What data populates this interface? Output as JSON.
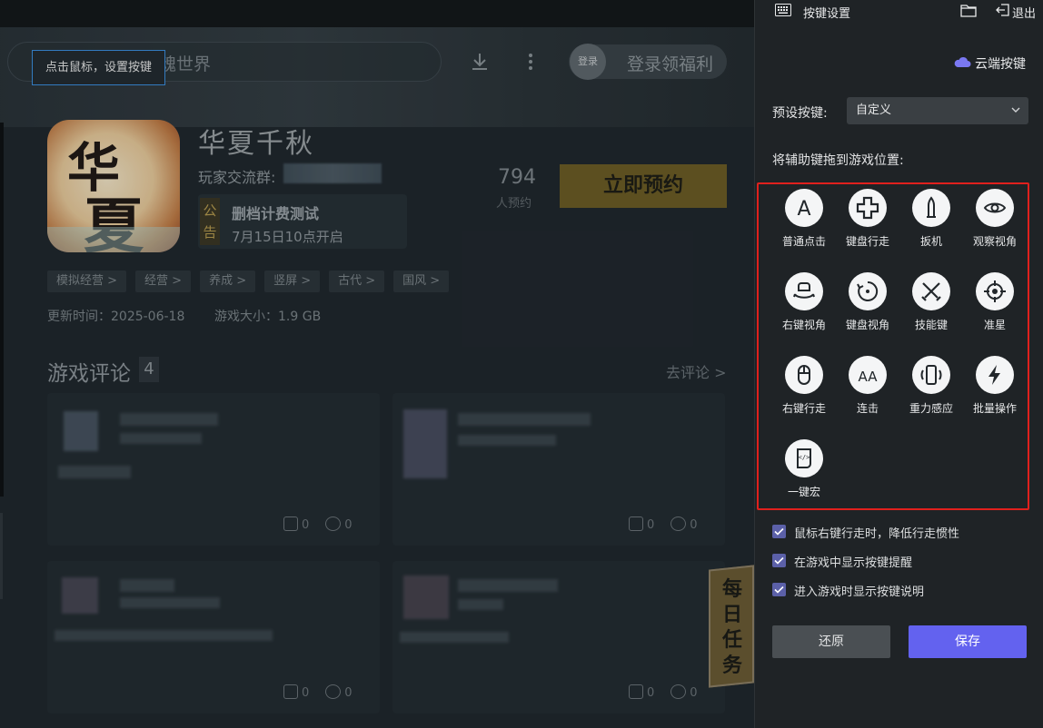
{
  "game_page": {
    "search_text": "魂世界",
    "tooltip": "点击鼠标，设置按键",
    "login_avatar": "登录",
    "login_text": "登录领福利",
    "title": "华夏千秋",
    "group_label": "玩家交流群:",
    "notice_tag": "公告",
    "notice_title": "删档计费测试",
    "notice_sub": "7月15日10点开启",
    "reserve_count": "794",
    "reserve_count_label": "人预约",
    "reserve_button": "立即预约",
    "tags": [
      "模拟经营 >",
      "经营 >",
      "养成 >",
      "竖屏 >",
      "古代 >",
      "国风 >"
    ],
    "update_time": "更新时间：2025-06-18",
    "game_size": "游戏大小：1.9 GB",
    "review_title": "游戏评论",
    "review_count": "4",
    "review_link": "去评论 >",
    "likes": "0",
    "comments": "0",
    "daily_task": "每日任务"
  },
  "panel": {
    "title": "按键设置",
    "exit": "退出",
    "cloud": "云端按键",
    "preset_label": "预设按键:",
    "preset_value": "自定义",
    "drag_label": "将辅助键拖到游戏位置:",
    "keys": [
      "普通点击",
      "键盘行走",
      "扳机",
      "观察视角",
      "右键视角",
      "键盘视角",
      "技能键",
      "准星",
      "右键行走",
      "连击",
      "重力感应",
      "批量操作",
      "一键宏"
    ],
    "options": [
      "鼠标右键行走时，降低行走惯性",
      "在游戏中显示按键提醒",
      "进入游戏时显示按键说明"
    ],
    "reset": "还原",
    "save": "保存"
  },
  "colors": {
    "accent": "#6362ef",
    "highlight_border": "#e0201d",
    "reserve_button": "#6c5b24"
  }
}
